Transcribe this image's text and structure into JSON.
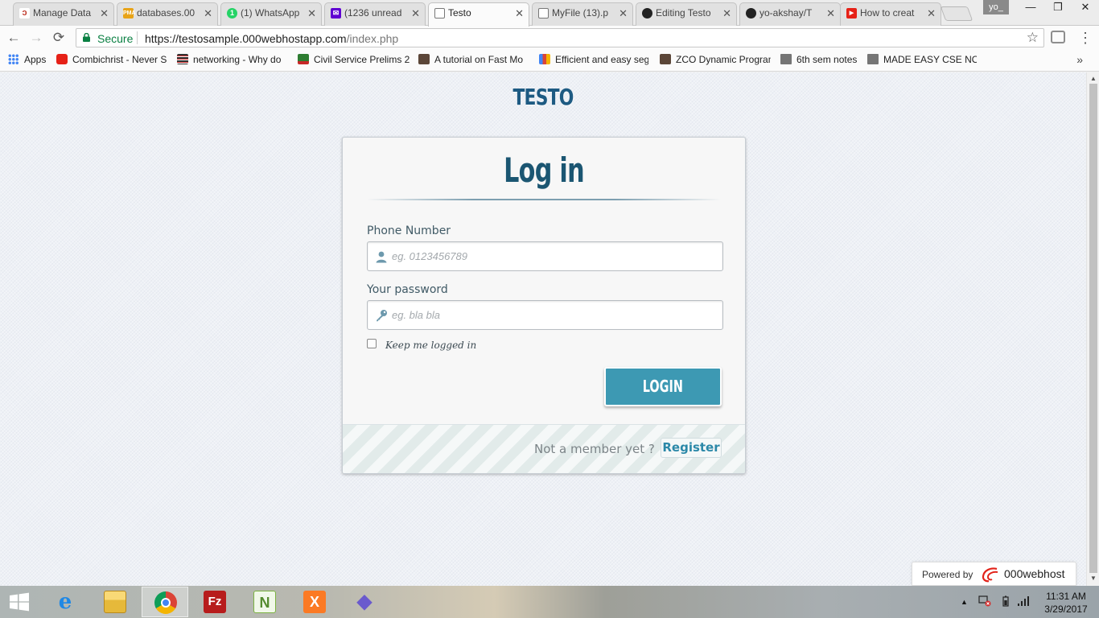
{
  "browser": {
    "tabs": [
      {
        "label": "Manage Data",
        "icon": "000webhost-icon",
        "color": "#c0392b",
        "active": false
      },
      {
        "label": "databases.00",
        "icon": "phpmyadmin-icon",
        "color": "#e8a317",
        "active": false
      },
      {
        "label": "(1) WhatsApp",
        "icon": "whatsapp-icon",
        "color": "#25d366",
        "badge": "1",
        "active": false
      },
      {
        "label": "(1236 unread",
        "icon": "yahoo-mail-icon",
        "color": "#6001d2",
        "active": false
      },
      {
        "label": "Testo",
        "icon": "page-icon",
        "color": "#ffffff",
        "active": true
      },
      {
        "label": "MyFile (13).p",
        "icon": "page-icon",
        "color": "#ffffff",
        "active": false
      },
      {
        "label": "Editing Testo",
        "icon": "github-icon",
        "color": "#222222",
        "active": false
      },
      {
        "label": "yo-akshay/T",
        "icon": "github-icon",
        "color": "#222222",
        "active": false
      },
      {
        "label": "How to creat",
        "icon": "youtube-icon",
        "color": "#e62117",
        "active": false
      }
    ],
    "profile_label": "yo_",
    "close_glyph": "✕",
    "window_controls": {
      "minimize": "—",
      "maximize": "❐",
      "close": "✕"
    },
    "nav": {
      "back": "←",
      "forward": "→",
      "reload": "⟳"
    },
    "secure_label": "Secure",
    "url_scheme_host": "https://testosample.000webhostapp.com",
    "url_path": "/index.php",
    "star_glyph": "☆",
    "menu_glyph": "⋮",
    "bookmarks": [
      {
        "label": "Apps",
        "icon": "apps-grid-icon",
        "color": "#4285f4"
      },
      {
        "label": "Combichrist - Never S",
        "icon": "youtube-icon",
        "color": "#e62117"
      },
      {
        "label": "networking - Why do",
        "icon": "stackexchange-icon",
        "color": "#333333"
      },
      {
        "label": "Civil Service Prelims 2",
        "icon": "ias-icon",
        "color": "#2e7d32"
      },
      {
        "label": "A tutorial on Fast Mo",
        "icon": "codechef-icon",
        "color": "#5b4638"
      },
      {
        "label": "Efficient and easy seg",
        "icon": "bar-chart-icon",
        "color": "#f4b400"
      },
      {
        "label": "ZCO Dynamic Program",
        "icon": "codechef-icon",
        "color": "#5b4638"
      },
      {
        "label": "6th sem notes",
        "icon": "folder-icon",
        "color": "#757575"
      },
      {
        "label": "MADE EASY CSE NOT",
        "icon": "folder-icon",
        "color": "#757575"
      }
    ],
    "bookmarks_more": "»"
  },
  "page": {
    "site_title": "TESTO",
    "form": {
      "title": "Log in",
      "phone_label": "Phone Number",
      "phone_placeholder": "eg. 0123456789",
      "phone_value": "",
      "password_label": "Your password",
      "password_placeholder": "eg. bla bla",
      "password_value": "",
      "remember_label": "Keep me logged in",
      "remember_checked": false,
      "login_button": "LOGIN",
      "member_prompt": "Not a member yet ?",
      "register_link": "Register"
    },
    "powered_by_label": "Powered by",
    "powered_by_brand": "000webhost"
  },
  "taskbar": {
    "apps": [
      {
        "name": "internet-explorer-icon",
        "glyph": "e",
        "color": "#1e88e5"
      },
      {
        "name": "file-explorer-icon",
        "glyph": "",
        "color": "#f4c542"
      },
      {
        "name": "chrome-icon",
        "glyph": "",
        "color": "#db4437",
        "active": true
      },
      {
        "name": "filezilla-icon",
        "glyph": "Fz",
        "color": "#b71c1c"
      },
      {
        "name": "notepadpp-icon",
        "glyph": "N",
        "color": "#7cb342"
      },
      {
        "name": "xampp-icon",
        "glyph": "X",
        "color": "#fb7a24"
      },
      {
        "name": "git-gui-icon",
        "glyph": "◆",
        "color": "#7a7a7a"
      }
    ],
    "tray_up": "▲",
    "time": "11:31 AM",
    "date": "3/29/2017"
  },
  "colors": {
    "accent": "#3d99b3",
    "title": "#1b5672",
    "secure_green": "#0b8043"
  }
}
